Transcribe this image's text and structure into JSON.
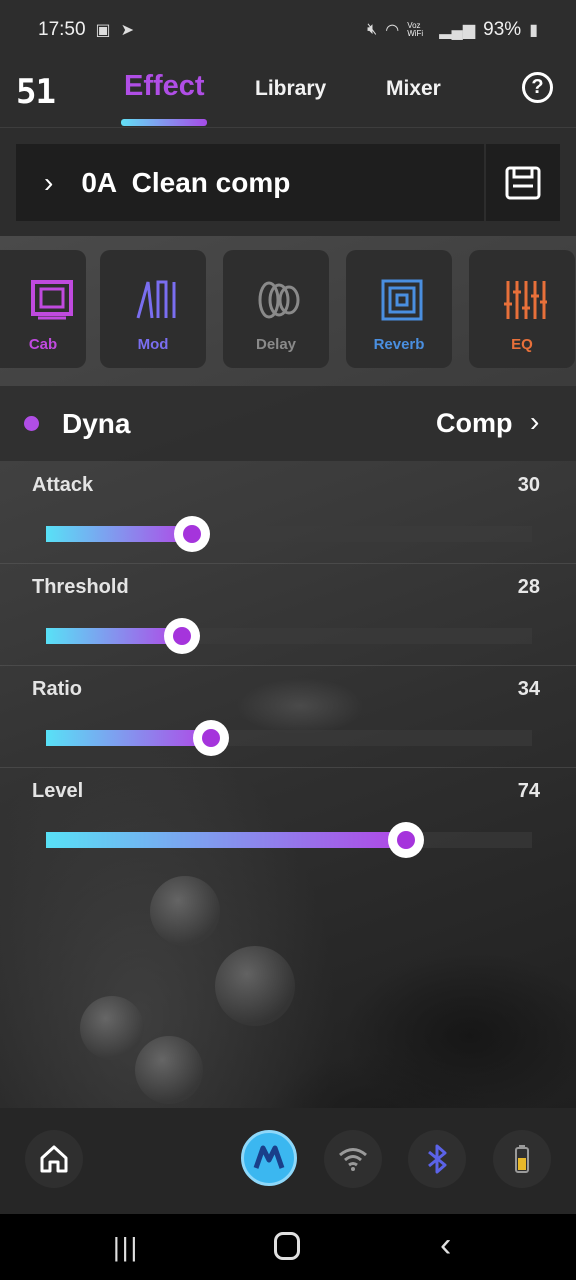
{
  "status": {
    "time": "17:50",
    "network_label": "Voz WiFi",
    "battery": "93%"
  },
  "nav": {
    "logo": "51",
    "tabs": [
      {
        "label": "Effect",
        "active": true
      },
      {
        "label": "Library",
        "active": false
      },
      {
        "label": "Mixer",
        "active": false
      }
    ],
    "help": "?"
  },
  "preset": {
    "name": "0A  Clean comp"
  },
  "modules": [
    {
      "label": "Cab",
      "color": "#c04adf",
      "icon": "cab-icon"
    },
    {
      "label": "Mod",
      "color": "#7a6ef0",
      "icon": "mod-icon"
    },
    {
      "label": "Delay",
      "color": "#8a8a8a",
      "icon": "delay-icon"
    },
    {
      "label": "Reverb",
      "color": "#4a8fe0",
      "icon": "reverb-icon"
    },
    {
      "label": "EQ",
      "color": "#e8703a",
      "icon": "eq-icon"
    }
  ],
  "effect": {
    "name": "Dyna",
    "type": "Comp",
    "accent": "#b04ee6"
  },
  "params": [
    {
      "label": "Attack",
      "value": "30",
      "level": 30
    },
    {
      "label": "Threshold",
      "value": "28",
      "level": 28
    },
    {
      "label": "Ratio",
      "value": "34",
      "level": 34
    },
    {
      "label": "Level",
      "value": "74",
      "level": 74
    }
  ],
  "bottom_nav": [
    "home-icon",
    "app-logo-icon",
    "wifi-icon",
    "bluetooth-icon",
    "battery-icon"
  ]
}
